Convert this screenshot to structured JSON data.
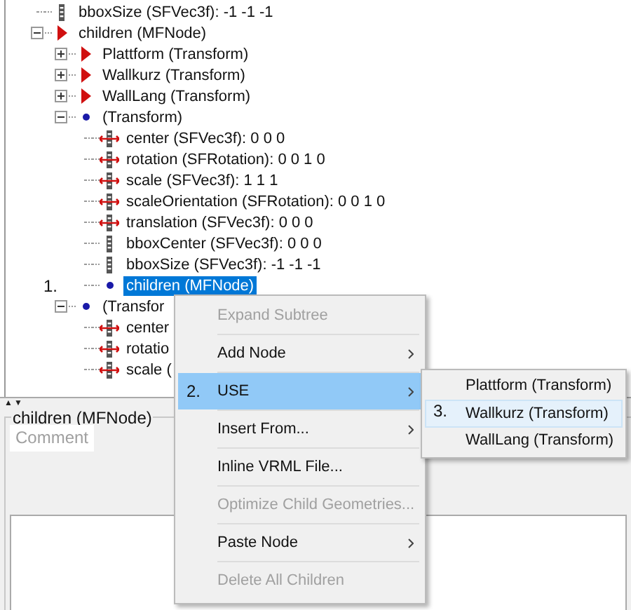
{
  "tree": [
    {
      "label": "bboxSize (SFVec3f): -1 -1 -1",
      "kind": "bbox",
      "selected": false
    },
    {
      "label": "children (MFNode)",
      "kind": "node",
      "expanded": true,
      "selected": false,
      "children": [
        {
          "label": "Plattform (Transform)",
          "kind": "node",
          "expanded": false,
          "selected": false
        },
        {
          "label": "Wallkurz (Transform)",
          "kind": "node",
          "expanded": false,
          "selected": false
        },
        {
          "label": "WallLang (Transform)",
          "kind": "node",
          "expanded": false,
          "selected": false
        },
        {
          "label": "(Transform)",
          "kind": "dot",
          "expanded": true,
          "selected": false,
          "children": [
            {
              "label": "center (SFVec3f): 0 0 0",
              "kind": "field",
              "selected": false
            },
            {
              "label": "rotation (SFRotation): 0 0 1 0",
              "kind": "field",
              "selected": false
            },
            {
              "label": "scale (SFVec3f): 1 1 1",
              "kind": "field",
              "selected": false
            },
            {
              "label": "scaleOrientation (SFRotation): 0 0 1 0",
              "kind": "field",
              "selected": false
            },
            {
              "label": "translation (SFVec3f): 0 0 0",
              "kind": "field",
              "selected": false
            },
            {
              "label": "bboxCenter (SFVec3f): 0 0 0",
              "kind": "bbox",
              "selected": false
            },
            {
              "label": "bboxSize (SFVec3f): -1 -1 -1",
              "kind": "bbox",
              "selected": false
            },
            {
              "label": "children (MFNode)",
              "kind": "dot",
              "selected": true,
              "annotation": "1."
            }
          ]
        },
        {
          "label": "(Transfor",
          "kind": "dot",
          "expanded": true,
          "selected": false,
          "children": [
            {
              "label": "center",
              "kind": "field",
              "selected": false
            },
            {
              "label": "rotatio",
              "kind": "field",
              "selected": false
            },
            {
              "label": "scale (",
              "kind": "field",
              "selected": false
            }
          ]
        }
      ]
    }
  ],
  "splitter": {
    "arrows": [
      "▲",
      "▼"
    ]
  },
  "panel": {
    "title": "children (MFNode)",
    "tabs": [
      {
        "label": "Comment",
        "selected": true,
        "disabled": true
      }
    ]
  },
  "context_menu": {
    "items": [
      {
        "label": "Expand Subtree",
        "disabled": true,
        "submenu": false,
        "selected": false
      },
      {
        "label": "Add Node",
        "disabled": false,
        "submenu": true,
        "selected": false
      },
      {
        "label": "USE",
        "disabled": false,
        "submenu": true,
        "selected": true,
        "annotation": "2."
      },
      {
        "label": "Insert From...",
        "disabled": false,
        "submenu": true,
        "selected": false
      },
      {
        "label": "Inline VRML File...",
        "disabled": false,
        "submenu": false,
        "selected": false
      },
      {
        "label": "Optimize Child Geometries...",
        "disabled": true,
        "submenu": false,
        "selected": false
      },
      {
        "label": "Paste Node",
        "disabled": false,
        "submenu": true,
        "selected": false
      },
      {
        "label": "Delete All Children",
        "disabled": true,
        "submenu": false,
        "selected": false
      }
    ]
  },
  "submenu": {
    "items": [
      {
        "label": "Plattform (Transform)",
        "selected": false
      },
      {
        "label": "Wallkurz (Transform)",
        "selected": true,
        "annotation": "3."
      },
      {
        "label": "WallLang (Transform)",
        "selected": false
      }
    ]
  }
}
